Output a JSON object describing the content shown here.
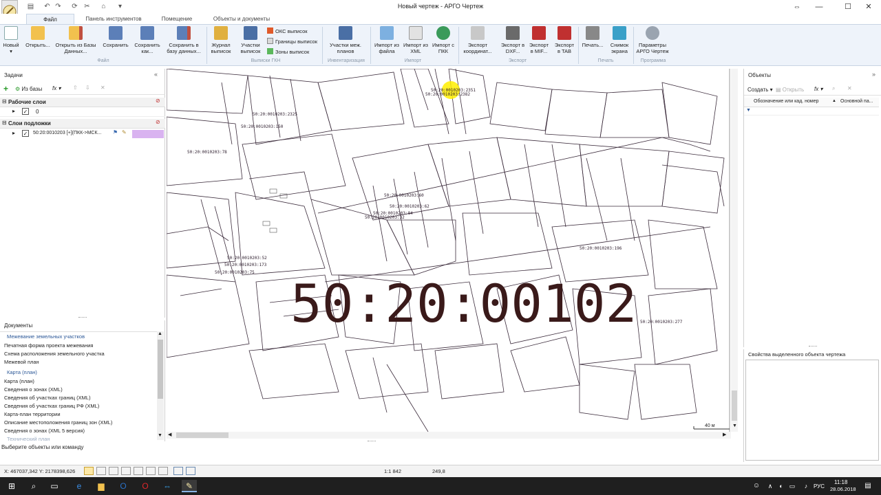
{
  "window": {
    "title": "Новый чертеж - АРГО Чертеж",
    "minimize": "—",
    "maximize": "☐",
    "close": "✕",
    "restore": "⇔"
  },
  "tabs": [
    {
      "label": "Файл",
      "active": true
    },
    {
      "label": "Панель инструментов",
      "active": false
    },
    {
      "label": "Помещение",
      "active": false
    },
    {
      "label": "Объекты и документы",
      "active": false
    }
  ],
  "ribbon": {
    "file": {
      "new": "Новый",
      "open": "Открыть...",
      "open_db": "Открыть из Базы Данных...",
      "save": "Сохранить",
      "save_as": "Сохранить как...",
      "save_db": "Сохранить в базу данных...",
      "group": "Файл"
    },
    "gkn": {
      "journal": "Журнал выписок",
      "parcels": "Участки выписок",
      "oks": "ОКС выписок",
      "borders": "Границы выписок",
      "zones": "Зоны выписок",
      "group": "Выписки ГКН"
    },
    "inventory": {
      "parcels_plans": "Участки меж. планов",
      "group": "Инвентаризация"
    },
    "import": {
      "from_file": "Импорт из файла",
      "from_xml": "Импорт из XML",
      "from_pkk": "Импорт с ПКК",
      "group": "Импорт"
    },
    "export": {
      "coords": "Экспорт координат...",
      "dxf": "Экспорт в DXF...",
      "mif": "Экспорт в MIF...",
      "tab": "Экспорт в TAB",
      "group": "Экспорт"
    },
    "print": {
      "print": "Печать...",
      "screenshot": "Снимок экрана",
      "group": "Печать"
    },
    "program": {
      "params": "Параметры АРГО Чертеж",
      "group": "Программа"
    }
  },
  "tasks": {
    "header": "Задачи",
    "from_db": "Из базы",
    "working_layers": "Рабочие слои",
    "layer_zero": "0",
    "base_layers": "Слои подложки",
    "base_layer_item": "50:20:0010203 [+](ПКК->МСК..."
  },
  "documents": {
    "header": "Документы",
    "group1": "Межевание земельных участков",
    "items1": [
      "Печатная форма проекта межевания",
      "Схема расположения земельного участка",
      "Межевой план"
    ],
    "group2": "Карта (план)",
    "items2": [
      "Карта (план)",
      "Сведения о зонах (XML)",
      "Сведения об участках границ (XML)",
      "Сведения об участках границ РФ (XML)",
      "Карта-план территории",
      "Описание местоположения границ зон (XML)",
      "Сведения о зонах (XML 5 версия)"
    ],
    "group3": "Технический план"
  },
  "objects": {
    "header": "Объекты",
    "create": "Создать",
    "open": "Открыть",
    "col1": "Обозначение или кад. номер",
    "col2": "Основной па..."
  },
  "properties": {
    "header": "Свойства выделенного объекта чертежа"
  },
  "map": {
    "big_label": "50:20:00102",
    "scale_bar": "40 м",
    "labels": [
      "50:20:0010203:2351",
      "50:20:0010203:2382",
      "50:20:0010203:2325",
      "50:20:0010203:150",
      "50:20:0010203:78",
      "50:20:0010203:60",
      "50:20:0010203:62",
      "50:20:0010203:84",
      "50:20:0010203:32",
      "50:20:0010203:196",
      "50:20:0010203:52",
      "50:20:0010203:173",
      "50:20:0010203:75",
      "50:20:0010203:277"
    ]
  },
  "status": {
    "prompt": "Выберите объекты или команду",
    "coords": "X: 467037,342 Y: 2178398,626",
    "scale": "1:1 842",
    "value": "249,8"
  },
  "taskbar": {
    "lang": "РУС",
    "time": "11:18",
    "date": "28.06.2018"
  },
  "colors": {
    "ribbon_bg": "#eef3fa",
    "accent": "#2b5797",
    "highlight": "#ffee00",
    "big_label": "#3a1a1a"
  }
}
